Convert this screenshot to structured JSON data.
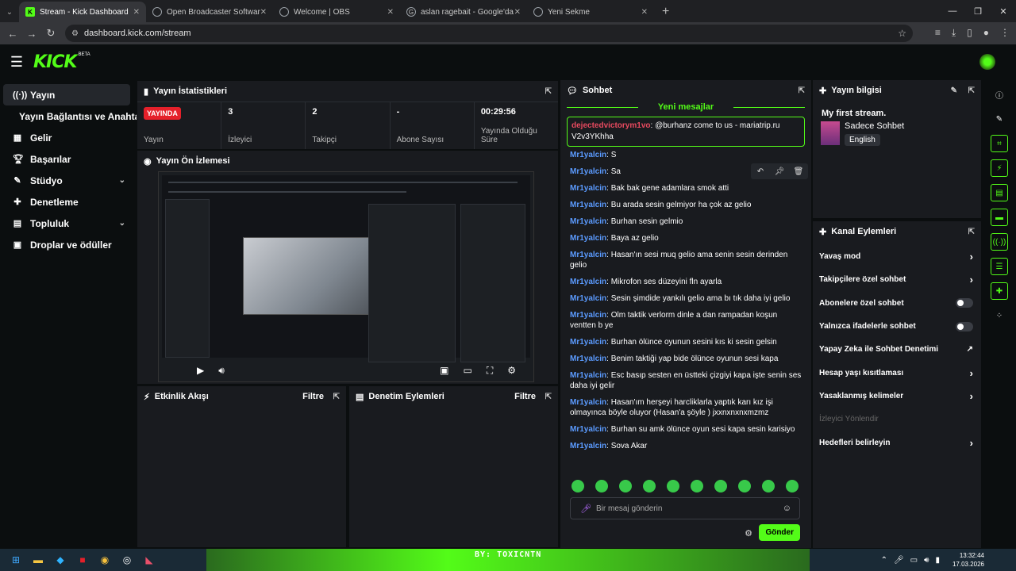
{
  "browser": {
    "tabs": [
      {
        "label": "Stream - Kick Dashboard",
        "active": true
      },
      {
        "label": "Open Broadcaster Software | O",
        "active": false
      },
      {
        "label": "Welcome | OBS",
        "active": false
      },
      {
        "label": "aslan ragebait - Google'da Ara",
        "active": false
      },
      {
        "label": "Yeni Sekme",
        "active": false
      }
    ],
    "url": "dashboard.kick.com/stream"
  },
  "brand": {
    "logo": "KICK",
    "beta": "BETA",
    "accent": "#53fc18"
  },
  "sidebar": {
    "items": [
      {
        "label": "Yayın",
        "icon": "broadcast-icon",
        "active": true
      },
      {
        "label": "Yayın Bağlantısı ve Anahtarı",
        "sub": true
      },
      {
        "label": "Gelir",
        "icon": "revenue-icon"
      },
      {
        "label": "Başarılar",
        "icon": "trophy-icon"
      },
      {
        "label": "Stüdyo",
        "icon": "studio-icon",
        "chevron": true
      },
      {
        "label": "Denetleme",
        "icon": "wrench-icon"
      },
      {
        "label": "Topluluk",
        "icon": "community-icon",
        "chevron": true
      },
      {
        "label": "Droplar ve ödüller",
        "icon": "drops-icon"
      }
    ]
  },
  "stats_panel": {
    "title": "Yayın İstatistikleri",
    "badge": "YAYINDA",
    "stats": [
      {
        "value": "",
        "label": "Yayın"
      },
      {
        "value": "3",
        "label": "İzleyici"
      },
      {
        "value": "2",
        "label": "Takipçi"
      },
      {
        "value": "-",
        "label": "Abone Sayısı"
      },
      {
        "value": "00:29:56",
        "label": "Yayında Olduğu Süre"
      }
    ]
  },
  "preview_panel": {
    "title": "Yayın Ön İzlemesi"
  },
  "activity_panel": {
    "title": "Etkinlik Akışı",
    "filter": "Filtre"
  },
  "moderation_panel": {
    "title": "Denetim Eylemleri",
    "filter": "Filtre"
  },
  "chat": {
    "title": "Sohbet",
    "new_messages": "Yeni mesajlar",
    "pinned": {
      "user": "dejectedvictorym1vo",
      "text": "@burhanz come to us - mariatrip.ru V2v3YKhha"
    },
    "messages": [
      {
        "user": "Mr1yalcin",
        "text": "S"
      },
      {
        "user": "Mr1yalcin",
        "text": "Sa"
      },
      {
        "user": "Mr1yalcin",
        "text": "Bak bak gene adamlara smok atti"
      },
      {
        "user": "Mr1yalcin",
        "text": "Bu arada sesin gelmiyor ha çok az gelio"
      },
      {
        "user": "Mr1yalcin",
        "text": "Burhan sesin gelmio"
      },
      {
        "user": "Mr1yalcin",
        "text": "Baya az gelio"
      },
      {
        "user": "Mr1yalcin",
        "text": "Hasan'ın sesi muq gelio ama senin sesin derinden gelio"
      },
      {
        "user": "Mr1yalcin",
        "text": "Mikrofon ses düzeyini fln ayarla"
      },
      {
        "user": "Mr1yalcin",
        "text": "Sesin şimdide yankılı gelio ama bı tık daha iyi gelio"
      },
      {
        "user": "Mr1yalcin",
        "text": "Olm taktik verlorm dinle a dan rampadan koşun ventten b ye"
      },
      {
        "user": "Mr1yalcin",
        "text": "Burhan ölünce oyunun sesini kıs ki sesin gelsin"
      },
      {
        "user": "Mr1yalcin",
        "text": "Benim taktiği yap bide ölünce oyunun sesi kapa"
      },
      {
        "user": "Mr1yalcin",
        "text": "Esc basıp sesten en üstteki çizgiyi kapa işte senin ses daha iyi gelir"
      },
      {
        "user": "Mr1yalcin",
        "text": "Hasan'ım herşeyi harcliklarla yaptık karı kız işi olmayınca böyle oluyor (Hasan'a şöyle ) jxxnxnxnxmzmz"
      },
      {
        "user": "Mr1yalcin",
        "text": "Burhan su amk ölünce oyun sesi kapa sesin karisiyo"
      },
      {
        "user": "Mr1yalcin",
        "text": "Sova Akar"
      }
    ],
    "placeholder": "Bir mesaj gönderin",
    "send": "Gönder"
  },
  "stream_info": {
    "title": "Yayın bilgisi",
    "stream_title": "My first stream.",
    "category": "Sadece Sohbet",
    "tag": "English"
  },
  "channel_actions": {
    "title": "Kanal Eylemleri",
    "items": [
      {
        "label": "Yavaş mod",
        "control": "chevron"
      },
      {
        "label": "Takipçilere özel sohbet",
        "control": "chevron"
      },
      {
        "label": "Abonelere özel sohbet",
        "control": "toggle"
      },
      {
        "label": "Yalnızca ifadelerle sohbet",
        "control": "toggle"
      },
      {
        "label": "Yapay Zeka ile Sohbet Denetimi",
        "control": "external"
      },
      {
        "label": "Hesap yaşı kısıtlaması",
        "control": "chevron"
      },
      {
        "label": "Yasaklanmış kelimeler",
        "control": "chevron"
      },
      {
        "label": "İzleyici Yönlendir",
        "control": "none",
        "disabled": true
      },
      {
        "label": "Hedefleri belirleyin",
        "control": "chevron"
      }
    ]
  },
  "overlay_text": "BY: TOXICNTN",
  "clock": {
    "time": "13:32:44",
    "date": "17.03.2026"
  }
}
